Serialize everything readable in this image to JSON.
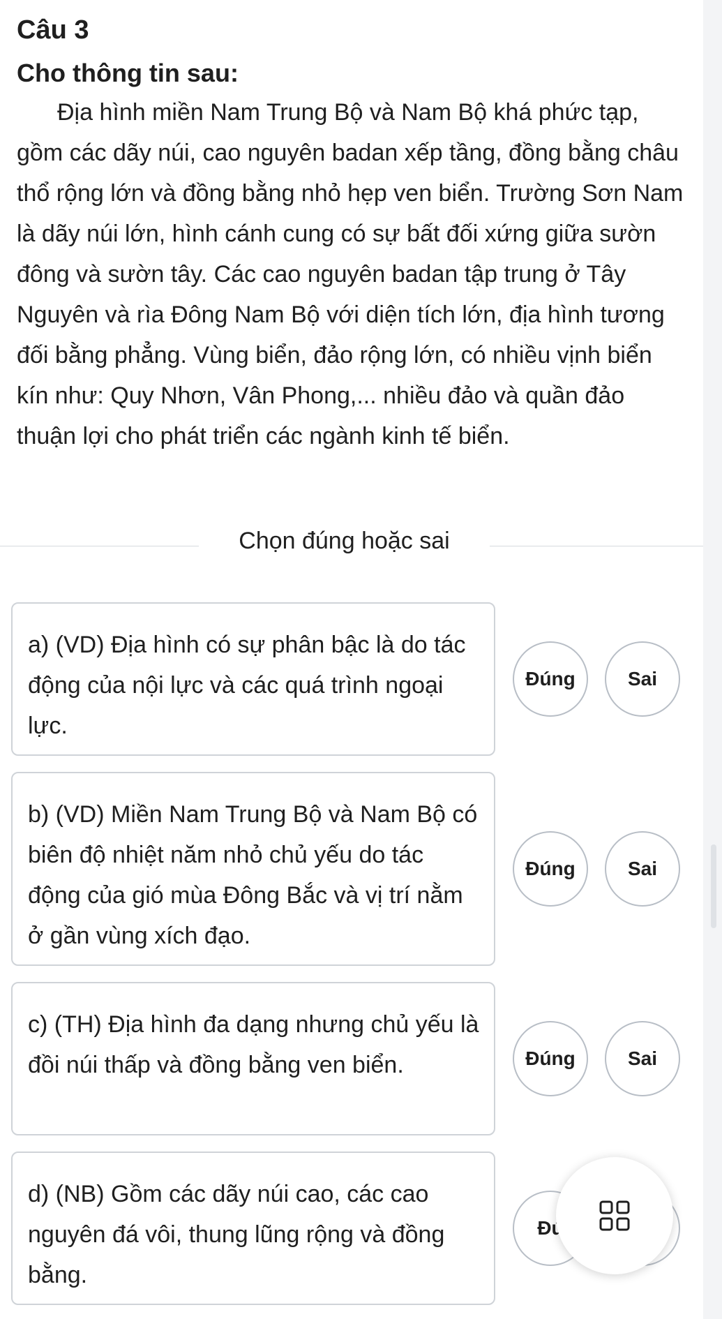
{
  "question": {
    "number": "Câu 3",
    "intro": "Cho thông tin sau:",
    "passage": "Địa hình miền Nam Trung Bộ và Nam Bộ khá phức tạp, gồm các dãy núi, cao nguyên badan xếp tầng, đồng bằng châu thổ rộng lớn và đồng bằng nhỏ hẹp ven biển. Trường Sơn Nam là dãy núi lớn, hình cánh cung có sự bất đối xứng giữa sườn đông và sườn tây. Các cao nguyên badan tập trung ở Tây Nguyên và rìa Đông Nam Bộ với diện tích lớn, địa hình tương đối bằng phẳng. Vùng biển, đảo rộng lớn, có nhiều vịnh biển kín như: Quy Nhơn, Vân Phong,... nhiều đảo và quần đảo thuận lợi cho phát triển các ngành kinh tế biển."
  },
  "section_label": "Chọn đúng hoặc sai",
  "statements": [
    {
      "text": "a) (VD) Địa hình có sự phân bậc là do tác động của nội lực và các quá trình ngoại lực.",
      "true_label": "Đúng",
      "false_label": "Sai"
    },
    {
      "text": "b) (VD) Miền Nam Trung Bộ và Nam Bộ có biên độ nhiệt năm nhỏ chủ yếu do tác động của gió mùa Đông Bắc và vị trí nằm ở gần vùng xích đạo.",
      "true_label": "Đúng",
      "false_label": "Sai"
    },
    {
      "text": "c) (TH) Địa hình đa dạng nhưng chủ yếu là đồi núi thấp và đồng bằng ven biển.",
      "true_label": "Đúng",
      "false_label": "Sai"
    },
    {
      "text": "d) (NB) Gồm các dãy núi cao, các cao nguyên đá vôi, thung lũng rộng và đồng bằng.",
      "true_label": "Đú",
      "false_label": ""
    }
  ],
  "fab": {
    "icon": "grid-icon"
  },
  "colors": {
    "border": "#cfd3d8",
    "divider": "#d6d9de",
    "text": "#1f1f1f",
    "gutter": "#f3f4f6"
  }
}
